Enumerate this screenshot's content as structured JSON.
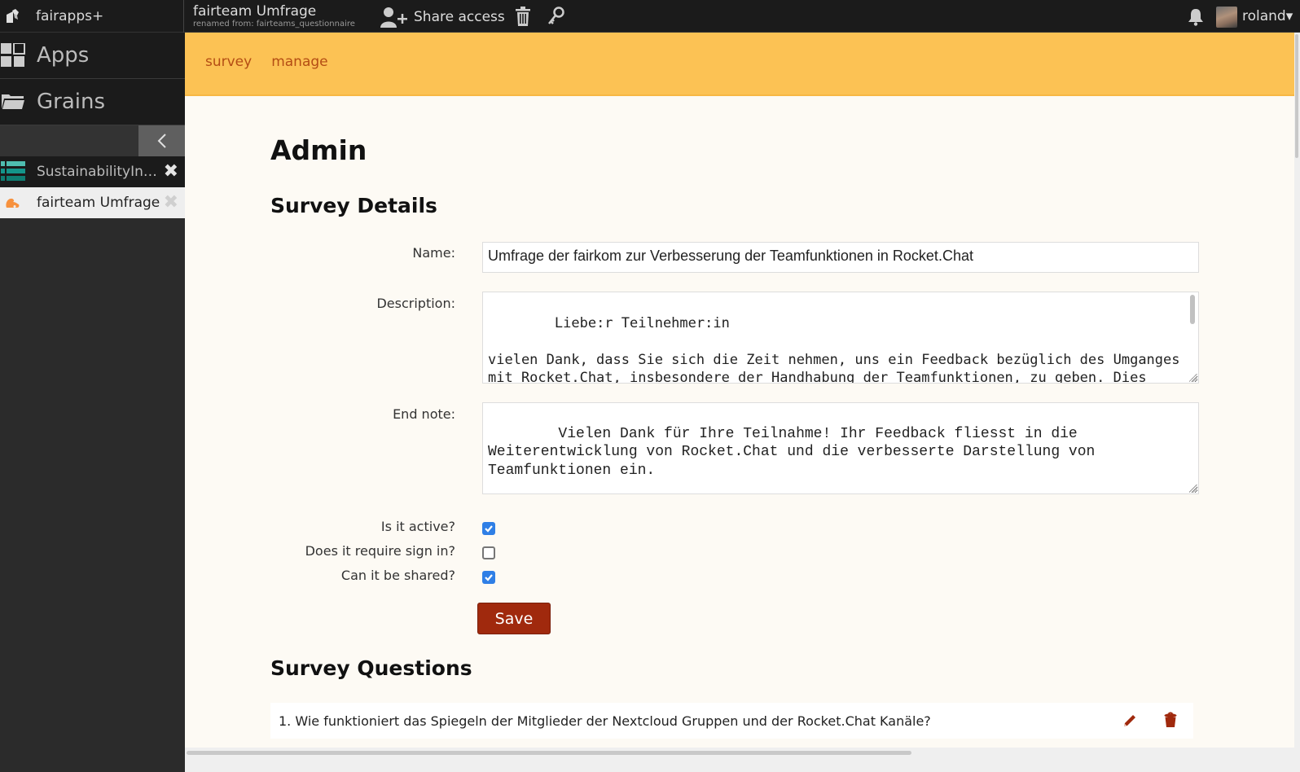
{
  "topbar": {
    "brand": "fairapps+",
    "grain_title": "fairteam Umfrage",
    "grain_subtitle": "renamed from: fairteams_questionnaire",
    "share_label": "Share access",
    "username": "roland",
    "user_caret": "▾"
  },
  "sidebar": {
    "nav": [
      {
        "label": "Apps",
        "icon": "apps-grid-icon"
      },
      {
        "label": "Grains",
        "icon": "folder-icon"
      }
    ],
    "collapse_glyph": "‹",
    "open_grains": [
      {
        "label": "SustainabilityIn…",
        "icon": "spreadsheet-icon",
        "active": false,
        "close": "✖"
      },
      {
        "label": "fairteam Umfrage",
        "icon": "survey-app-icon",
        "active": true,
        "close": "✖"
      }
    ]
  },
  "subnav": {
    "links": [
      "survey",
      "manage"
    ]
  },
  "page": {
    "title": "Admin",
    "details_heading": "Survey Details",
    "name_label": "Name:",
    "name_value": "Umfrage der fairkom zur Verbesserung der Teamfunktionen in Rocket.Chat",
    "description_label": "Description:",
    "description_value": "Liebe:r Teilnehmer:in\n\nvielen Dank, dass Sie sich die Zeit nehmen, uns ein Feedback bezüglich des Umganges mit Rocket.Chat, insbesondere der Handhabung der Teamfunktionen, zu geben. Dies ermöglicht es uns, der fairkom, gemeinsam mit Rocket.Chat an",
    "endnote_label": "End note:",
    "endnote_value": "Vielen Dank für Ihre Teilnahme! Ihr Feedback fliesst in die Weiterentwicklung von Rocket.Chat und die verbesserte Darstellung von Teamfunktionen ein.",
    "checkboxes": [
      {
        "label": "Is it active?",
        "checked": true
      },
      {
        "label": "Does it require sign in?",
        "checked": false
      },
      {
        "label": "Can it be shared?",
        "checked": true
      }
    ],
    "save_label": "Save",
    "questions_heading": "Survey Questions",
    "questions": [
      {
        "text": "1. Wie funktioniert das Spiegeln der Mitglieder der Nextcloud Gruppen und der Rocket.Chat Kanäle?"
      }
    ]
  },
  "colors": {
    "accent_bar": "#fcc254",
    "link": "#b44d14",
    "primary_button": "#a0290d",
    "checkbox_checked": "#2f7fe6"
  }
}
